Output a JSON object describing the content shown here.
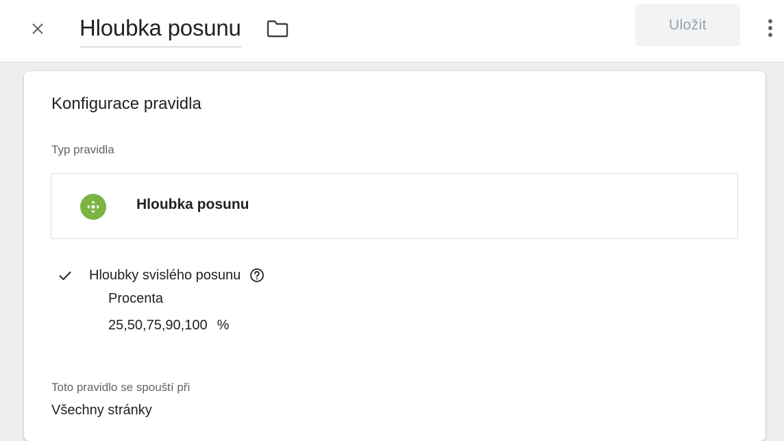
{
  "header": {
    "title": "Hloubka posunu",
    "save_label": "Uložit",
    "close_icon": "close-icon",
    "folder_icon": "folder-icon",
    "more_icon": "more-vert-icon"
  },
  "card": {
    "title": "Konfigurace pravidla",
    "type_label": "Typ pravidla",
    "type_name": "Hloubka posunu",
    "type_icon": "scroll-move-icon",
    "type_icon_color": "#7cb342",
    "vertical": {
      "label": "Hloubky svislého posunu",
      "checked": true,
      "units": "Procenta",
      "values": "25,50,75,90,100",
      "percent_sign": "%"
    },
    "fires_label": "Toto pravidlo se spouští při",
    "fires_value": "Všechny stránky"
  }
}
